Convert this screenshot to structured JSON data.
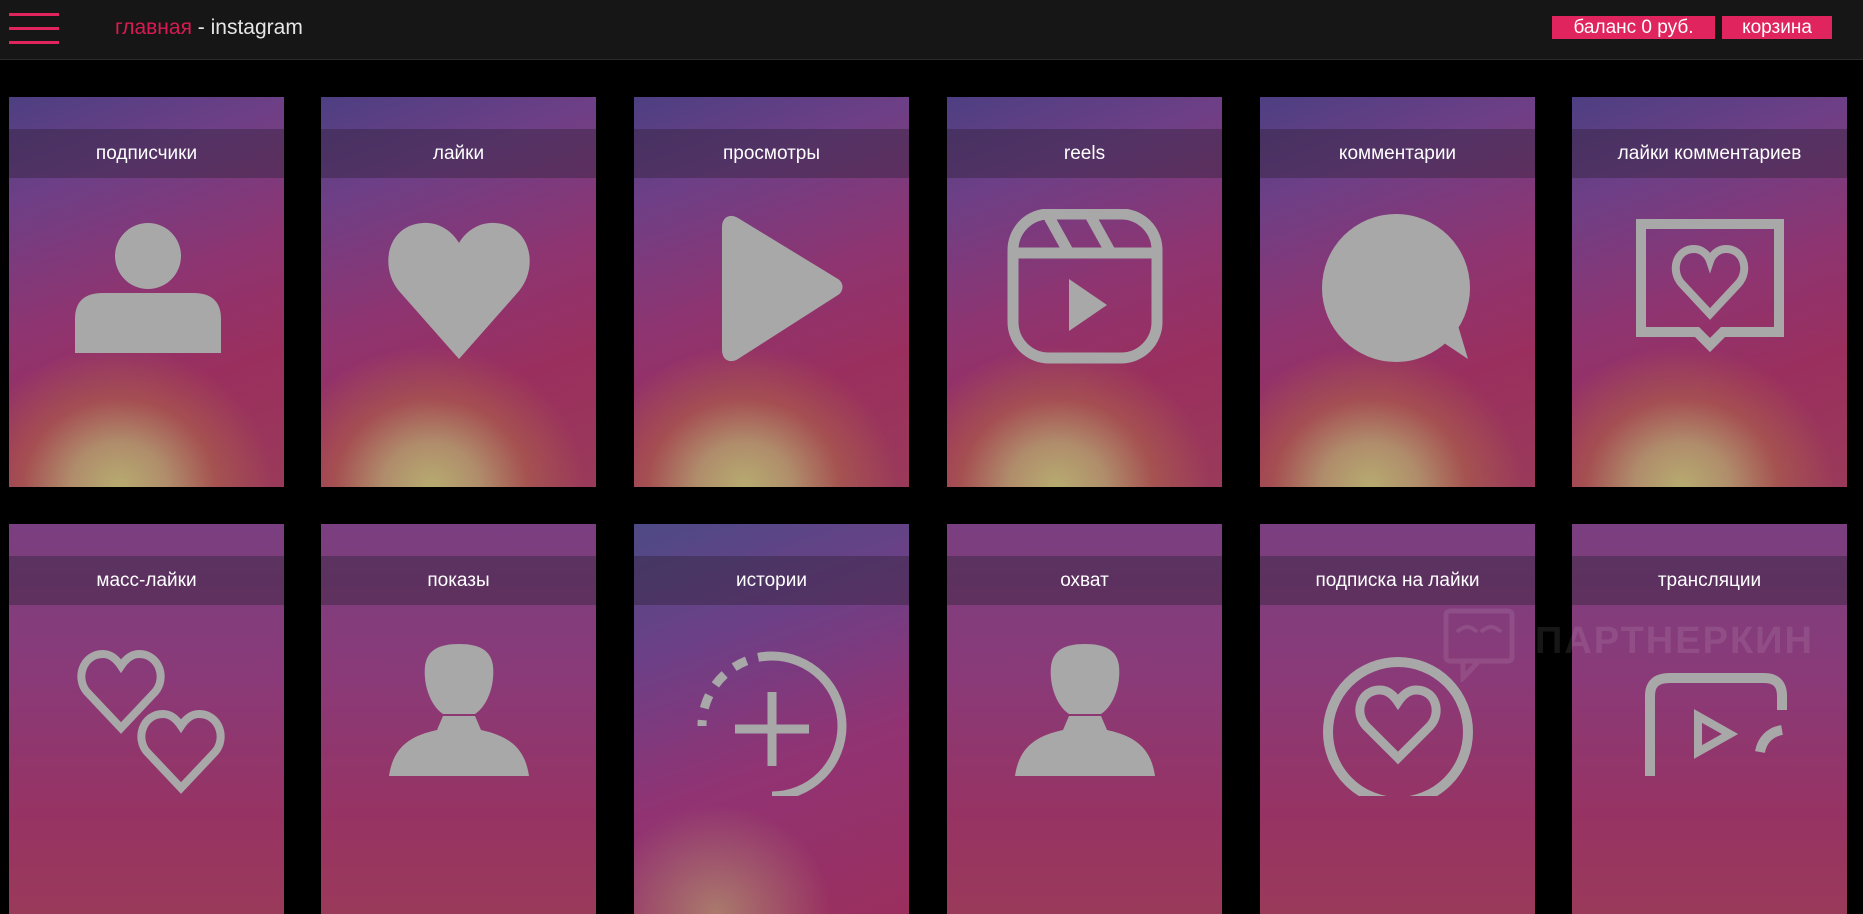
{
  "header": {
    "breadcrumb_home": "главная",
    "breadcrumb_sep": " - ",
    "breadcrumb_current": "instagram",
    "balance_label": "баланс 0 руб.",
    "cart_label": "корзина"
  },
  "cards": [
    {
      "label": "подписчики",
      "icon": "user-icon"
    },
    {
      "label": "лайки",
      "icon": "heart-icon"
    },
    {
      "label": "просмотры",
      "icon": "play-icon"
    },
    {
      "label": "reels",
      "icon": "reels-icon"
    },
    {
      "label": "комментарии",
      "icon": "comment-bubble-icon"
    },
    {
      "label": "лайки комментариев",
      "icon": "heart-message-icon"
    },
    {
      "label": "масс-лайки",
      "icon": "two-hearts-icon"
    },
    {
      "label": "показы",
      "icon": "person-icon"
    },
    {
      "label": "истории",
      "icon": "story-add-icon"
    },
    {
      "label": "охват",
      "icon": "person-icon"
    },
    {
      "label": "подписка на лайки",
      "icon": "heart-circle-icon"
    },
    {
      "label": "трансляции",
      "icon": "live-video-icon"
    }
  ],
  "watermark": "ПАРТНЕРКИН",
  "colors": {
    "accent": "#e0245e",
    "topbar": "#161616",
    "icon": "#a8a8a8"
  }
}
